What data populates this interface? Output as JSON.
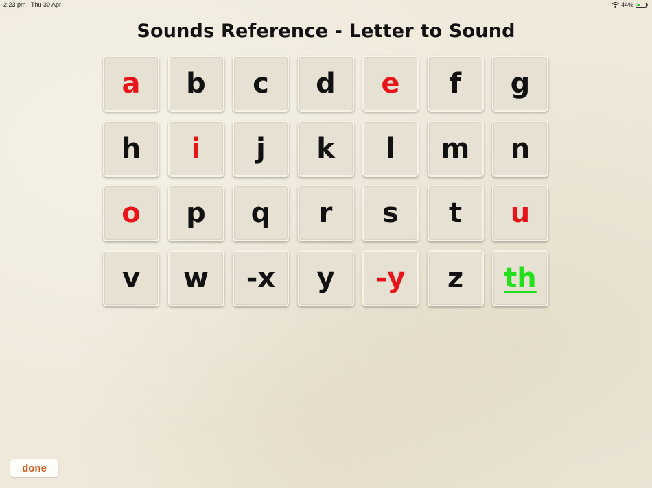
{
  "status_bar": {
    "time": "2:23 pm",
    "date": "Thu 30 Apr",
    "battery": "44%",
    "battery_level": 0.44
  },
  "page": {
    "title": "Sounds Reference - Letter to Sound"
  },
  "colors": {
    "consonant": "#111111",
    "vowel": "#e8141a",
    "digraph": "#22e01c",
    "done": "#d05a1e"
  },
  "tiles": [
    {
      "label": "a",
      "kind": "vowel"
    },
    {
      "label": "b",
      "kind": "consonant"
    },
    {
      "label": "c",
      "kind": "consonant"
    },
    {
      "label": "d",
      "kind": "consonant"
    },
    {
      "label": "e",
      "kind": "vowel"
    },
    {
      "label": "f",
      "kind": "consonant"
    },
    {
      "label": "g",
      "kind": "consonant"
    },
    {
      "label": "h",
      "kind": "consonant"
    },
    {
      "label": "i",
      "kind": "vowel"
    },
    {
      "label": "j",
      "kind": "consonant"
    },
    {
      "label": "k",
      "kind": "consonant"
    },
    {
      "label": "l",
      "kind": "consonant"
    },
    {
      "label": "m",
      "kind": "consonant"
    },
    {
      "label": "n",
      "kind": "consonant"
    },
    {
      "label": "o",
      "kind": "vowel"
    },
    {
      "label": "p",
      "kind": "consonant"
    },
    {
      "label": "q",
      "kind": "consonant"
    },
    {
      "label": "r",
      "kind": "consonant"
    },
    {
      "label": "s",
      "kind": "consonant"
    },
    {
      "label": "t",
      "kind": "consonant"
    },
    {
      "label": "u",
      "kind": "vowel"
    },
    {
      "label": "v",
      "kind": "consonant"
    },
    {
      "label": "w",
      "kind": "consonant"
    },
    {
      "label": "-x",
      "kind": "consonant"
    },
    {
      "label": "y",
      "kind": "consonant"
    },
    {
      "label": "-y",
      "kind": "vowel"
    },
    {
      "label": "z",
      "kind": "consonant"
    },
    {
      "label": "th",
      "kind": "digraph",
      "underlined": true
    }
  ],
  "footer": {
    "done_label": "done"
  }
}
